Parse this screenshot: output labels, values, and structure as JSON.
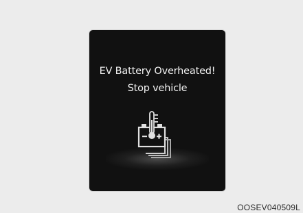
{
  "display": {
    "line1": "EV Battery Overheated!",
    "line2": "Stop vehicle",
    "icon": "battery-overheat-icon"
  },
  "caption": "OOSEV040509L",
  "colors": {
    "background": "#ececec",
    "screen": "#111111",
    "text": "#f2f2f2",
    "icon": "#d9d9d9"
  }
}
